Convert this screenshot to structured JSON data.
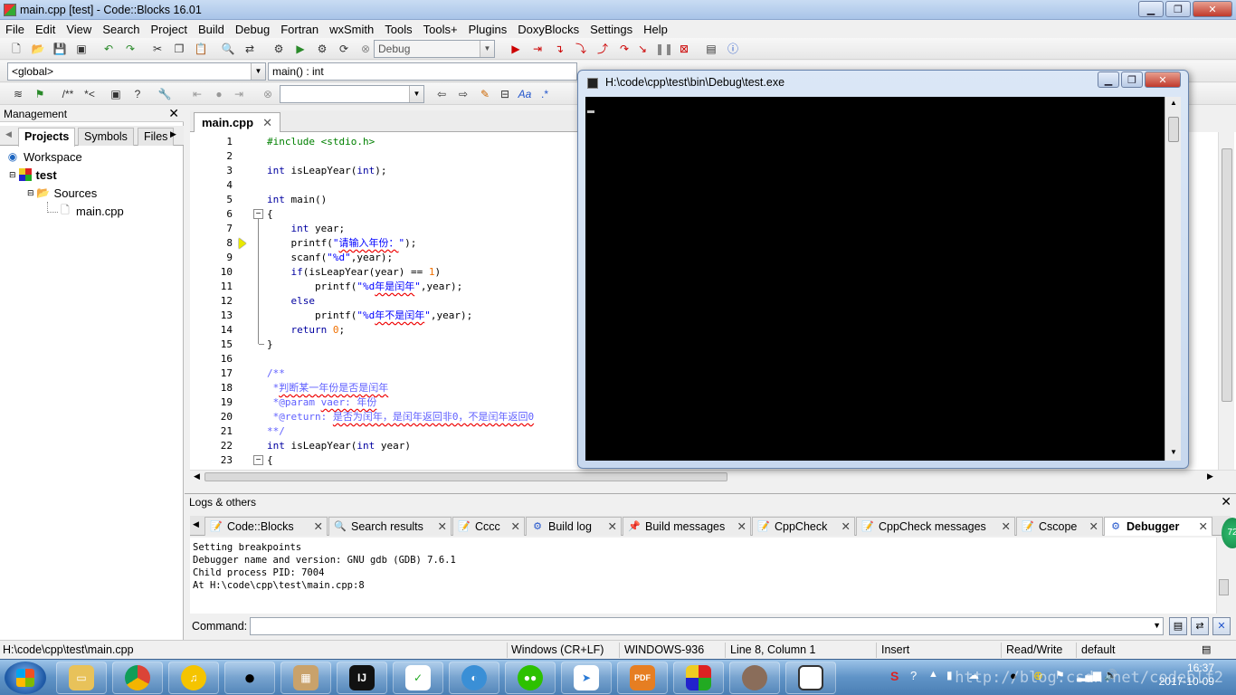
{
  "window": {
    "title": "main.cpp [test] - Code::Blocks 16.01"
  },
  "menu": [
    "File",
    "Edit",
    "View",
    "Search",
    "Project",
    "Build",
    "Debug",
    "Fortran",
    "wxSmith",
    "Tools",
    "Tools+",
    "Plugins",
    "DoxyBlocks",
    "Settings",
    "Help"
  ],
  "toolbar": {
    "build_target": "Debug",
    "scope": "<global>",
    "function": "main() : int",
    "doxy_comment": "/**",
    "doxy_inline": "*<",
    "regex_label": ".*"
  },
  "management": {
    "title": "Management",
    "tabs": [
      "Projects",
      "Symbols",
      "Files"
    ],
    "tree": {
      "workspace": "Workspace",
      "project": "test",
      "folder": "Sources",
      "file": "main.cpp"
    }
  },
  "editor": {
    "tab": "main.cpp",
    "line_numbers": [
      "1",
      "2",
      "3",
      "4",
      "5",
      "6",
      "7",
      "8",
      "9",
      "10",
      "11",
      "12",
      "13",
      "14",
      "15",
      "16",
      "17",
      "18",
      "19",
      "20",
      "21",
      "22",
      "23"
    ]
  },
  "console": {
    "title": "H:\\code\\cpp\\test\\bin\\Debug\\test.exe"
  },
  "logs": {
    "title": "Logs & others",
    "tabs": [
      "Code::Blocks",
      "Search results",
      "Cccc",
      "Build log",
      "Build messages",
      "CppCheck",
      "CppCheck messages",
      "Cscope",
      "Debugger"
    ],
    "text": "Setting breakpoints\nDebugger name and version: GNU gdb (GDB) 7.6.1\nChild process PID: 7004\nAt H:\\code\\cpp\\test\\main.cpp:8",
    "command_label": "Command:"
  },
  "statusbar": {
    "path": "H:\\code\\cpp\\test\\main.cpp",
    "eol": "Windows (CR+LF)",
    "encoding": "WINDOWS-936",
    "position": "Line 8, Column 1",
    "mode": "Insert",
    "access": "Read/Write",
    "profile": "default"
  },
  "taskbar": {
    "time": "16:37",
    "date": "2017-10-09",
    "watermark": "http://blog.csdn.net/codeblf2",
    "badge": "72"
  },
  "colors": {
    "accent": "#0000a0",
    "preprocessor": "#008000",
    "string": "#0000ff",
    "number": "#f07000",
    "comment": "#6060ff"
  }
}
